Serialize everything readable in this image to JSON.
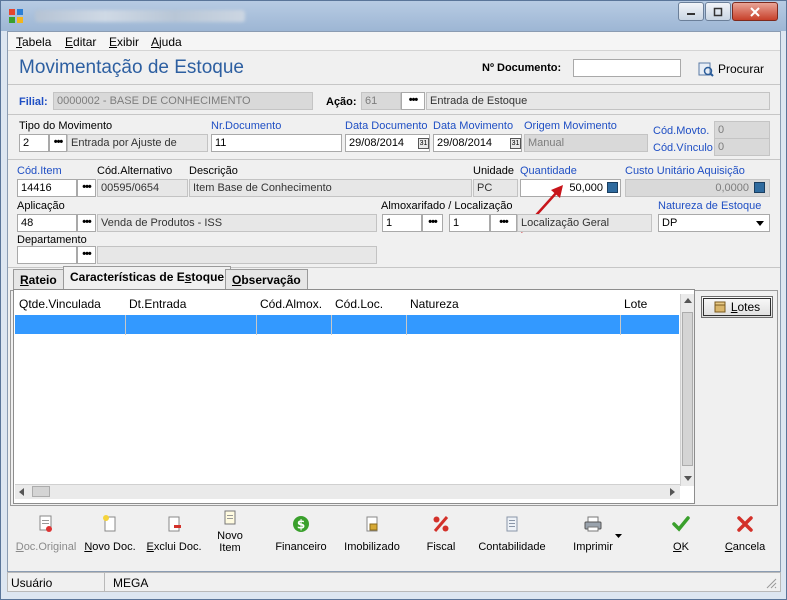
{
  "window": {
    "controls": [
      "minimize",
      "maximize",
      "close"
    ]
  },
  "menu": {
    "items": [
      {
        "label": "Tabela",
        "u": "T",
        "rest": "abela"
      },
      {
        "label": "Editar",
        "u": "E",
        "rest": "ditar"
      },
      {
        "label": "Exibir",
        "u": "E",
        "rest": "xibir"
      },
      {
        "label": "Ajuda",
        "u": "A",
        "rest": "juda"
      }
    ]
  },
  "header": {
    "title": "Movimentação de Estoque",
    "doc_number_label": "Nº Documento:",
    "doc_number_value": "",
    "search_button": "Procurar"
  },
  "filial": {
    "label": "Filial:",
    "value": "0000002 - BASE DE CONHECIMENTO",
    "acao_label": "Ação:",
    "acao_code": "61",
    "acao_desc": "Entrada de Estoque"
  },
  "movimento": {
    "tipo_label": "Tipo do Movimento",
    "tipo_code": "2",
    "tipo_desc": "Entrada por Ajuste de",
    "nr_doc_label": "Nr.Documento",
    "nr_doc_value": "11",
    "data_doc_label": "Data Documento",
    "data_doc_value": "29/08/2014",
    "data_mov_label": "Data Movimento",
    "data_mov_value": "29/08/2014",
    "origem_label": "Origem Movimento",
    "origem_value": "Manual",
    "cod_movto_label": "Cód.Movto.",
    "cod_movto_value": "0",
    "cod_vinculo_label": "Cód.Vínculo",
    "cod_vinculo_value": "0"
  },
  "item": {
    "cod_item_label": "Cód.Item",
    "cod_item_value": "14416",
    "cod_alt_label": "Cód.Alternativo",
    "cod_alt_value": "00595/0654",
    "descricao_label": "Descrição",
    "descricao_value": "Item Base de Conhecimento",
    "unidade_label": "Unidade",
    "unidade_value": "PC",
    "quantidade_label": "Quantidade",
    "quantidade_value": "50,000",
    "custo_label": "Custo Unitário Aquisição",
    "custo_value": "0,0000",
    "aplicacao_label": "Aplicação",
    "aplicacao_code": "48",
    "aplicacao_desc": "Venda de Produtos - ISS",
    "almox_label": "Almoxarifado / Localização",
    "almox_code": "1",
    "local_code": "1",
    "local_desc": "Localização Geral",
    "natureza_label": "Natureza de Estoque",
    "natureza_value": "DP",
    "departamento_label": "Departamento",
    "departamento_code": "",
    "departamento_desc": ""
  },
  "tabs": [
    {
      "label": "Rateio",
      "u": "R",
      "rest": "ateio"
    },
    {
      "label": "Características de Estoque",
      "pre": "Características de E",
      "u": "s",
      "rest": "toque"
    },
    {
      "label": "Observação",
      "u": "O",
      "rest": "bservação"
    }
  ],
  "grid": {
    "columns": [
      "Qtde.Vinculada",
      "Dt.Entrada",
      "Cód.Almox.",
      "Cód.Loc.",
      "Natureza",
      "Lote"
    ],
    "rows": [
      [
        "",
        "",
        "",
        "",
        "",
        ""
      ]
    ]
  },
  "lotes_button": {
    "u": "L",
    "rest": "otes"
  },
  "toolbar": [
    {
      "label": "Doc.Original",
      "u": "D",
      "rest": "oc.Original",
      "icon": "doc-original-icon",
      "disabled": true
    },
    {
      "label": "Novo Doc.",
      "u": "N",
      "rest": "ovo Doc.",
      "icon": "new-doc-icon",
      "disabled": false
    },
    {
      "label": "Exclui Doc.",
      "u": "E",
      "rest": "xclui Doc.",
      "icon": "delete-doc-icon",
      "disabled": false
    },
    {
      "label": "Novo Item",
      "u": "",
      "rest": "Novo Item",
      "icon": "new-item-icon",
      "disabled": false
    },
    {
      "label": "Financeiro",
      "u": "",
      "rest": "Financeiro",
      "icon": "dollar-icon",
      "disabled": false
    },
    {
      "label": "Imobilizado",
      "u": "",
      "rest": "Imobilizado",
      "icon": "lock-icon",
      "disabled": false
    },
    {
      "label": "Fiscal",
      "u": "",
      "rest": "Fiscal",
      "icon": "percent-icon",
      "disabled": false
    },
    {
      "label": "Contabilidade",
      "u": "",
      "rest": "Contabilidade",
      "icon": "ledger-icon",
      "disabled": false
    },
    {
      "label": "Imprimir",
      "u": "",
      "rest": "Imprimir",
      "icon": "printer-icon",
      "disabled": false
    },
    {
      "label": "OK",
      "u": "O",
      "rest": "K",
      "icon": "check-icon",
      "disabled": false
    },
    {
      "label": "Cancela",
      "u": "C",
      "rest": "ancela",
      "icon": "cancel-icon",
      "disabled": false
    }
  ],
  "status": {
    "user_label": "Usuário",
    "user_value": "MEGA"
  },
  "colors": {
    "title_blue": "#2d5fa1",
    "label_blue": "#1f4fc4",
    "selection": "#3399ff",
    "ok_green": "#3aa02c",
    "cancel_red": "#d3312a"
  }
}
